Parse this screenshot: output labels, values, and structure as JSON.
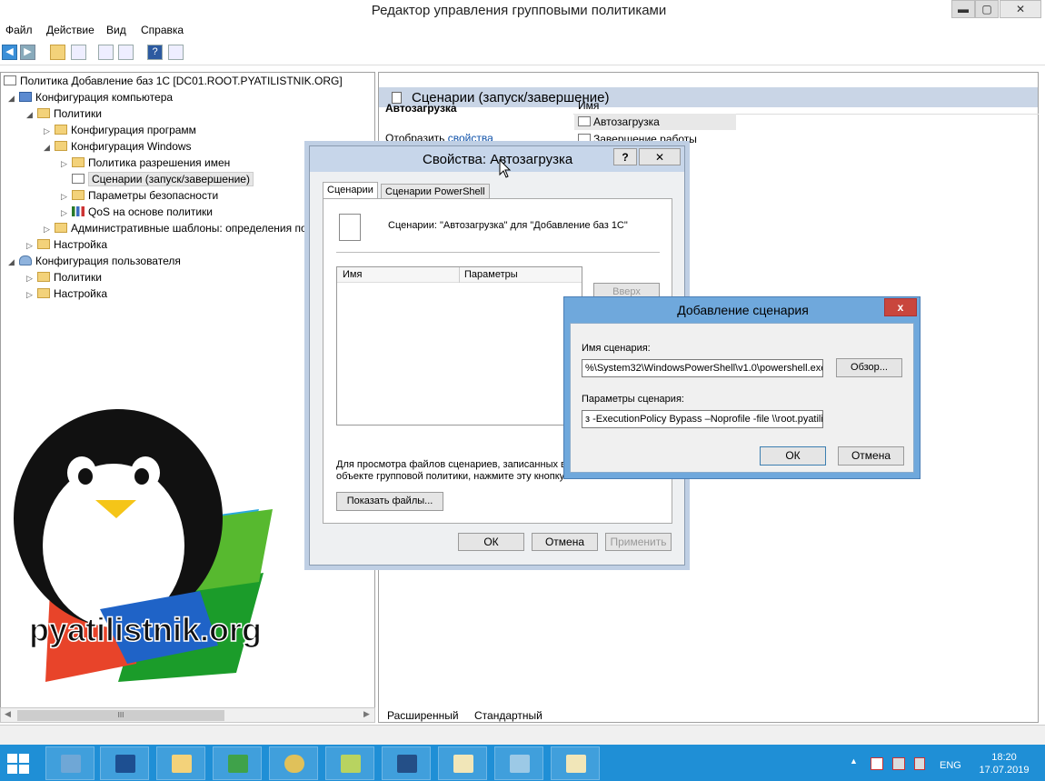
{
  "window": {
    "title": "Редактор управления групповыми политиками",
    "min_glyph": "▬",
    "max_glyph": "▢",
    "close_glyph": "✕"
  },
  "menu": [
    "Файл",
    "Действие",
    "Вид",
    "Справка"
  ],
  "toolbar_icons": [
    "back-icon",
    "forward-icon",
    "up-folder-icon",
    "show-hide-tree-icon",
    "export-list-icon",
    "properties-icon",
    "help-icon",
    "console-icon"
  ],
  "tree": {
    "root": "Политика Добавление баз 1С [DC01.ROOT.PYATILISTNIK.ORG]",
    "computer_config": "Конфигурация компьютера",
    "policies": "Политики",
    "software_config": "Конфигурация программ",
    "windows_config": "Конфигурация Windows",
    "name_resolution": "Политика разрешения имен",
    "scripts": "Сценарии (запуск/завершение)",
    "security": "Параметры безопасности",
    "qos": "QoS на основе политики",
    "admin_templates": "Административные шаблоны: определения по",
    "settings": "Настройка",
    "user_config": "Конфигурация пользователя",
    "user_policies": "Политики",
    "user_settings": "Настройка",
    "scroll_thumb": "III"
  },
  "right": {
    "title": "Сценарии (запуск/завершение)",
    "section": "Автозагрузка",
    "show_label": "Отобразить",
    "show_link": "свойства",
    "col_name": "Имя",
    "items": [
      "Автозагрузка",
      "Завершение работы"
    ],
    "tab_extended": "Расширенный",
    "tab_standard": "Стандартный"
  },
  "props_dialog": {
    "title": "Свойства: Автозагрузка",
    "help": "?",
    "close": "✕",
    "tab1": "Сценарии",
    "tab2": "Сценарии PowerShell",
    "description": "Сценарии: \"Автозагрузка\" для \"Добавление баз 1С\"",
    "col_name": "Имя",
    "col_params": "Параметры",
    "up": "Вверх",
    "footer_text_1": "Для просмотра файлов сценариев, записанных в",
    "footer_text_2": "объекте групповой политики, нажмите эту кнопку",
    "show_files": "Показать файлы...",
    "ok": "ОК",
    "cancel": "Отмена",
    "apply": "Применить"
  },
  "add_dialog": {
    "title": "Добавление сценария",
    "close": "x",
    "name_label": "Имя сценария:",
    "name_value": "%\\System32\\WindowsPowerShell\\v1.0\\powershell.exe",
    "browse": "Обзор...",
    "params_label": "Параметры сценария:",
    "params_value": "з -ExecutionPolicy Bypass –Noprofile -file \\\\root.pyatilistn",
    "ok": "ОК",
    "cancel": "Отмена"
  },
  "watermark": "pyatilistnik.org",
  "taskbar": {
    "lang": "ENG",
    "time": "18:20",
    "date": "17.07.2019",
    "tray_arrow": "▲"
  }
}
